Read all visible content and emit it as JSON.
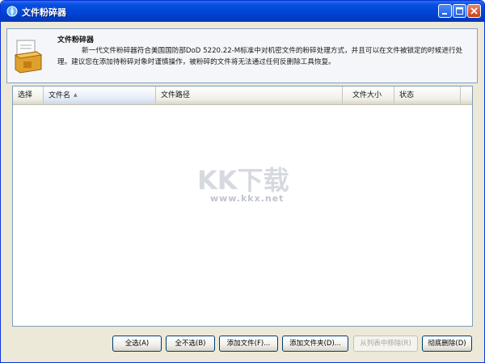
{
  "window": {
    "title": "文件粉碎器",
    "minimize_icon": "minimize-icon",
    "maximize_icon": "maximize-icon",
    "close_icon": "close-icon"
  },
  "info": {
    "icon": "shredder-icon",
    "title": "文件粉碎器",
    "description": "新一代文件粉碎器符合美国国防部DoD 5220.22-M标准中对机密文件的粉碎处理方式，并且可以在文件被锁定的时候进行处理。建议您在添加待粉碎对象时谨慎操作，被粉碎的文件将无法通过任何反删除工具恢复。"
  },
  "list": {
    "columns": [
      "选择",
      "文件名",
      "文件路径",
      "文件大小",
      "状态"
    ],
    "sorted_column": "文件名",
    "rows": []
  },
  "watermark": {
    "text": "KK下载",
    "url": "www.kkx.net"
  },
  "buttons": {
    "select_all": "全选(A)",
    "select_none": "全不选(B)",
    "add_file": "添加文件(F)...",
    "add_folder": "添加文件夹(D)...",
    "remove_from_list": "从列表中移除(R)",
    "delete_completely": "彻底删除(D)"
  },
  "colors": {
    "titlebar": "#0047d8",
    "window_bg": "#ece9d8",
    "list_border": "#7f9db9"
  }
}
